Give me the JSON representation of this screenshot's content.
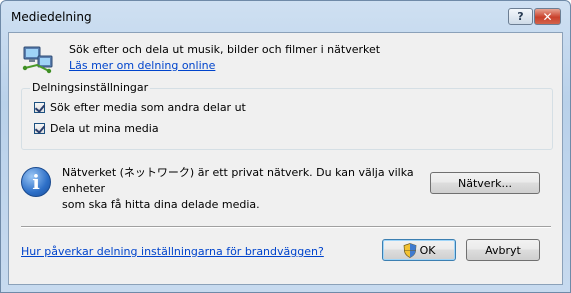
{
  "window": {
    "title": "Mediedelning",
    "help_label": "?",
    "close_label": "✕"
  },
  "header": {
    "description": "Sök efter och dela ut musik, bilder och filmer i nätverket",
    "learn_more_link": "Läs mer om delning online"
  },
  "sharing_settings": {
    "group_label": "Delningsinställningar",
    "options": [
      {
        "label": "Sök efter media som andra delar ut",
        "checked": true
      },
      {
        "label": "Dela ut mina media",
        "checked": true
      }
    ]
  },
  "info": {
    "icon": "information-icon",
    "line1": "Nätverket (ネットワーク) är ett privat nätverk. Du kan välja vilka enheter",
    "line2": "som ska få hitta dina delade media."
  },
  "buttons": {
    "network_label": "Nätverk...",
    "ok_label": "OK",
    "cancel_label": "Avbryt"
  },
  "footer": {
    "firewall_link": "Hur påverkar delning inställningarna för brandväggen?"
  }
}
